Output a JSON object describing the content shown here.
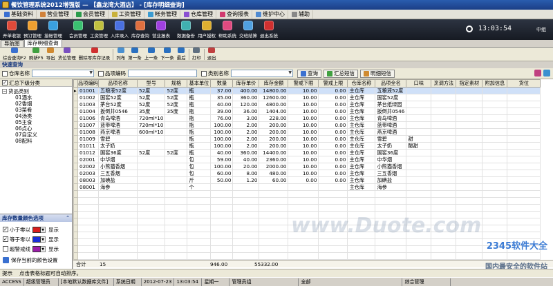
{
  "window": {
    "title": "餐饮管理系统2012增强版 — 【鑫龙湾大酒店】 - [库存明细查询]"
  },
  "menu": [
    {
      "label": "基础资料",
      "color": "#3a6fd1"
    },
    {
      "label": "营业管理",
      "color": "#d1823a"
    },
    {
      "label": "会员管理",
      "color": "#2b9b4a"
    },
    {
      "label": "工资管理",
      "color": "#c9b13a"
    },
    {
      "label": "帐务管理",
      "color": "#3a9bd1"
    },
    {
      "label": "仓库管理",
      "color": "#8a4fd1"
    },
    {
      "label": "查询报表",
      "color": "#d13a6f"
    },
    {
      "label": "维护中心",
      "color": "#4f8ad1"
    },
    {
      "label": "辅助",
      "color": "#888888"
    }
  ],
  "big_toolbar": [
    {
      "label": "开单收银",
      "color": "#e04a3a"
    },
    {
      "label": "预订管理",
      "color": "#f0a030"
    },
    {
      "label": "接帐管理",
      "color": "#3aa0e0"
    },
    {
      "sep": true
    },
    {
      "label": "会员管理",
      "color": "#3ac070"
    },
    {
      "label": "工资管理",
      "color": "#c0c040"
    },
    {
      "label": "入库录入",
      "color": "#4a70e0"
    },
    {
      "label": "库存查询",
      "color": "#e07040"
    },
    {
      "label": "营业报表",
      "color": "#a040e0"
    },
    {
      "sep": true
    },
    {
      "label": "数据备份",
      "color": "#40b0b0"
    },
    {
      "label": "用户授权",
      "color": "#e0b030"
    },
    {
      "label": "帮助系统",
      "color": "#e04a80"
    },
    {
      "label": "交班结算",
      "color": "#50a0e0"
    },
    {
      "label": "退出系统",
      "color": "#d03030"
    }
  ],
  "clock": "13:03:54",
  "user": "中组",
  "tabs": [
    {
      "label": "导航图",
      "active": false
    },
    {
      "label": "库存明细查询",
      "active": true
    }
  ],
  "small_toolbar": [
    {
      "label": "综合查询F2",
      "color": "#3a70d0"
    },
    {
      "label": "刷新F5",
      "color": "#40a040"
    },
    {
      "label": "导出",
      "color": "#d08a30"
    },
    {
      "label": "货位管理",
      "color": "#7a50c0"
    },
    {
      "label": "删除零库存记录",
      "color": "#d03030",
      "big": true
    },
    {
      "sep": true
    },
    {
      "label": "列布",
      "color": "#4a90d0"
    },
    {
      "label": "第一条",
      "color": "#2a70c0"
    },
    {
      "label": "上一条",
      "color": "#2a70c0"
    },
    {
      "label": "下一条",
      "color": "#2a70c0"
    },
    {
      "label": "最后",
      "color": "#2a70c0"
    },
    {
      "sep": true
    },
    {
      "label": "打印",
      "color": "#607080"
    },
    {
      "sep": true
    },
    {
      "label": "退出",
      "color": "#c04040"
    }
  ],
  "quick_query": {
    "title": "快速查询"
  },
  "filters": {
    "warehouse_label": "仓库名称",
    "code_label": "品项编码",
    "category_label": "类别名称",
    "query_btn": "查询",
    "summary_btn": "汇总短信",
    "detail_btn": "明细短信"
  },
  "left": {
    "summary_label": "汇总下级分类",
    "tree_root": "货品类别",
    "tree_items": [
      "01酒水",
      "02香烟",
      "03菜肴",
      "04汤类",
      "05主食",
      "06点心",
      "07自定义",
      "08配料"
    ],
    "color_section_title": "库存数量颜色选项",
    "color_rows": [
      {
        "checked": true,
        "label": "小于零以",
        "color": "#d81e1e",
        "show": "显示"
      },
      {
        "checked": true,
        "label": "等于零以",
        "color": "#1a2fd8",
        "show": "显示"
      },
      {
        "checked": false,
        "label": "超警戒线",
        "color": "#9b1ea8",
        "show": "显示"
      }
    ],
    "save_colors": "保存当前的颜色设置"
  },
  "grid": {
    "columns": [
      "品项编码",
      "品项名称",
      "型号",
      "规格",
      "基本单位",
      "数量",
      "库存单价",
      "库存金额",
      "警戒下限",
      "警戒上限",
      "仓库名称",
      "品项全名",
      "口味",
      "烹调方法",
      "指定素材",
      "附加信息",
      "货位"
    ],
    "rows": [
      [
        "01001",
        "五粮液52度",
        "52度",
        "52度",
        "瓶",
        "37.00",
        "400.00",
        "14800.00",
        "10.00",
        "0.00",
        "主仓库",
        "五粮液52度",
        "",
        "",
        "",
        "",
        ""
      ],
      [
        "01002",
        "国窖52度",
        "52度",
        "52度",
        "瓶",
        "35.00",
        "360.00",
        "12600.00",
        "10.00",
        "0.00",
        "主仓库",
        "国窖52度",
        "",
        "",
        "",
        "",
        ""
      ],
      [
        "01003",
        "茅台52度",
        "52度",
        "52度",
        "瓶",
        "40.00",
        "120.00",
        "4800.00",
        "10.00",
        "0.00",
        "主仓库",
        "茅台纸绿园",
        "",
        "",
        "",
        "",
        ""
      ],
      [
        "01004",
        "扳倒井0546",
        "35度",
        "35度",
        "瓶",
        "39.00",
        "36.00",
        "1404.00",
        "10.00",
        "0.00",
        "主仓库",
        "扳倒井0546",
        "",
        "",
        "",
        "",
        ""
      ],
      [
        "01006",
        "青岛啤酒",
        "720ml*10",
        "",
        "瓶",
        "76.00",
        "3.00",
        "228.00",
        "10.00",
        "0.00",
        "主仓库",
        "青岛啤酒",
        "",
        "",
        "",
        "",
        ""
      ],
      [
        "01007",
        "蓝带啤酒",
        "720ml*10",
        "",
        "瓶",
        "100.00",
        "2.00",
        "200.00",
        "10.00",
        "0.00",
        "主仓库",
        "蓝带啤酒",
        "",
        "",
        "",
        "",
        ""
      ],
      [
        "01008",
        "燕京啤酒",
        "600ml*10",
        "",
        "瓶",
        "100.00",
        "2.00",
        "200.00",
        "10.00",
        "0.00",
        "主仓库",
        "燕京啤酒",
        "",
        "",
        "",
        "",
        ""
      ],
      [
        "01009",
        "雪碧",
        "",
        "",
        "瓶",
        "100.00",
        "2.00",
        "200.00",
        "10.00",
        "0.00",
        "主仓库",
        "雪碧",
        "甜",
        "",
        "",
        "",
        ""
      ],
      [
        "01011",
        "太子奶",
        "",
        "",
        "瓶",
        "100.00",
        "2.00",
        "200.00",
        "10.00",
        "0.00",
        "主仓库",
        "太子奶",
        "酸甜",
        "",
        "",
        "",
        ""
      ],
      [
        "01012",
        "国窖36度",
        "52度",
        "52度",
        "瓶",
        "40.00",
        "360.00",
        "14400.00",
        "10.00",
        "0.00",
        "主仓库",
        "国窖36度",
        "",
        "",
        "",
        "",
        ""
      ],
      [
        "02001",
        "中华烟",
        "",
        "",
        "包",
        "59.00",
        "40.00",
        "2360.00",
        "10.00",
        "0.00",
        "主仓库",
        "中华烟",
        "",
        "",
        "",
        "",
        ""
      ],
      [
        "02002",
        "小熊猫香烟",
        "",
        "",
        "包",
        "100.00",
        "20.00",
        "2000.00",
        "10.00",
        "0.00",
        "主仓库",
        "小熊猫香烟",
        "",
        "",
        "",
        "",
        ""
      ],
      [
        "02003",
        "三五香烟",
        "",
        "",
        "包",
        "60.00",
        "8.00",
        "480.00",
        "10.00",
        "0.00",
        "主仓库",
        "三五香烟",
        "",
        "",
        "",
        "",
        ""
      ],
      [
        "08003",
        "加碘盐",
        "",
        "",
        "斤",
        "50.00",
        "1.20",
        "60.00",
        "0.00",
        "0.00",
        "主仓库",
        "加碘盐",
        "",
        "",
        "",
        "",
        ""
      ],
      [
        "08001",
        "海参",
        "",
        "",
        "个",
        "",
        "",
        "",
        "",
        "",
        "主仓库",
        "海参",
        "",
        "",
        "",
        "",
        ""
      ]
    ],
    "total_label": "合计",
    "total_count": "15",
    "total_qty": "946.00",
    "total_amount": "55332.00"
  },
  "watermark": "www.Duote.com",
  "corner_logo": "2345软件大全",
  "corner_logo2": "国内最安全的软件站",
  "hint": {
    "label": "提示",
    "text": "点击表格标题可自动排序。"
  },
  "status": [
    "ACCESS",
    "超级管理员",
    "[本地默认数据库文件]",
    "系统日期",
    "2012-07-23",
    "13:03:54",
    "星期一",
    "管理员组",
    "全部",
    "综合管理"
  ]
}
